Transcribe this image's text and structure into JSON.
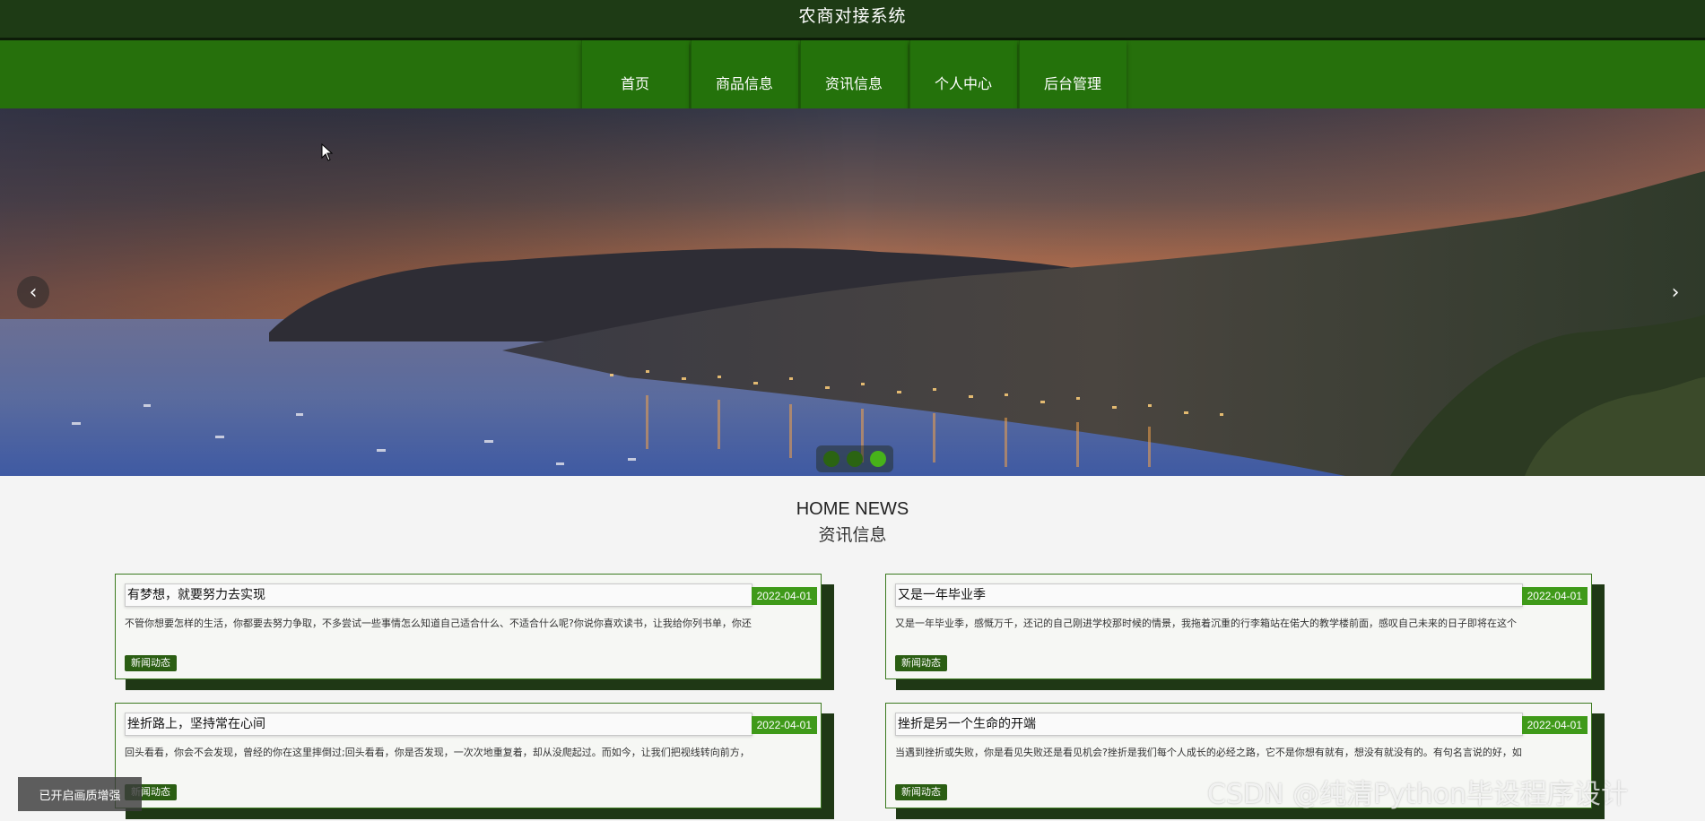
{
  "site": {
    "title": "农商对接系统"
  },
  "nav": {
    "items": [
      {
        "label": "首页"
      },
      {
        "label": "商品信息"
      },
      {
        "label": "资讯信息"
      },
      {
        "label": "个人中心"
      },
      {
        "label": "后台管理"
      }
    ]
  },
  "banner": {
    "slides_total": 3,
    "active_slide": 3,
    "prev_icon": "chevron-left-icon",
    "next_icon": "chevron-right-icon"
  },
  "news": {
    "heading_en": "HOME NEWS",
    "heading_cn": "资讯信息",
    "cards": [
      {
        "title": "有梦想，就要努力去实现",
        "date": "2022-04-01",
        "desc": "不管你想要怎样的生活，你都要去努力争取，不多尝试一些事情怎么知道自己适合什么、不适合什么呢?你说你喜欢读书，让我给你列书单，你还",
        "tag": "新闻动态"
      },
      {
        "title": "又是一年毕业季",
        "date": "2022-04-01",
        "desc": "又是一年毕业季，感慨万千，还记的自己刚进学校那时候的情景，我拖着沉重的行李箱站在偌大的教学楼前面，感叹自己未来的日子即将在这个",
        "tag": "新闻动态"
      },
      {
        "title": "挫折路上，坚持常在心间",
        "date": "2022-04-01",
        "desc": "回头看看，你会不会发现，曾经的你在这里摔倒过;回头看看，你是否发现，一次次地重复着，却从没爬起过。而如今，让我们把视线转向前方，",
        "tag": "新闻动态"
      },
      {
        "title": "挫折是另一个生命的开端",
        "date": "2022-04-01",
        "desc": "当遇到挫折或失败，你是看见失败还是看见机会?挫折是我们每个人成长的必经之路，它不是你想有就有，想没有就没有的。有句名言说的好，如",
        "tag": "新闻动态"
      }
    ]
  },
  "overlay": {
    "toast": "已开启画质增强",
    "watermark": "CSDN @纯清Python毕设程序设计"
  },
  "colors": {
    "topbar": "#1e3b15",
    "navbar": "#26700c",
    "accent": "#3f9a19",
    "tag": "#2b5e13"
  }
}
